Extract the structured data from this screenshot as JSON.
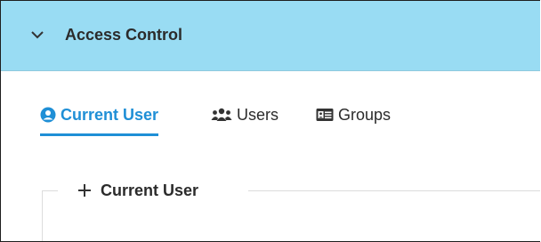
{
  "header": {
    "title": "Access Control",
    "toggle_icon": "chevron-down-icon"
  },
  "tabs": [
    {
      "label": "Current User",
      "icon": "user-circle-icon",
      "active": true
    },
    {
      "label": "Users",
      "icon": "users-icon",
      "active": false
    },
    {
      "label": "Groups",
      "icon": "id-card-icon",
      "active": false
    }
  ],
  "section": {
    "label": "Current User",
    "icon": "plus-icon"
  },
  "colors": {
    "header_bg": "#99dcf3",
    "accent": "#1f8fd6"
  }
}
